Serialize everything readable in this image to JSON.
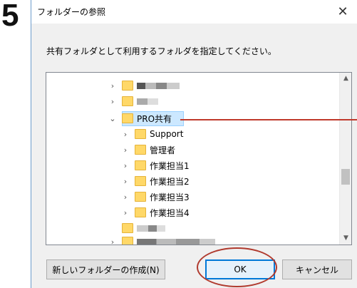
{
  "step_number": "5",
  "dialog": {
    "title": "フォルダーの参照",
    "close_glyph": "✕",
    "instruction": "共有フォルダとして利用するフォルダを指定してください。"
  },
  "tree": {
    "items": [
      {
        "label": "",
        "expanded": false,
        "level": 0,
        "blurred": true
      },
      {
        "label": "",
        "expanded": false,
        "level": 0,
        "blurred": true
      },
      {
        "label": "PRO共有",
        "expanded": true,
        "level": 0,
        "selected": true
      },
      {
        "label": "Support",
        "expanded": false,
        "level": 1
      },
      {
        "label": "管理者",
        "expanded": false,
        "level": 1
      },
      {
        "label": "作業担当1",
        "expanded": false,
        "level": 1
      },
      {
        "label": "作業担当2",
        "expanded": false,
        "level": 1
      },
      {
        "label": "作業担当3",
        "expanded": false,
        "level": 1
      },
      {
        "label": "作業担当4",
        "expanded": false,
        "level": 1
      },
      {
        "label": "",
        "expanded": false,
        "level": 0,
        "blurred": true
      },
      {
        "label": "",
        "expanded": false,
        "level": 0,
        "blurred": true
      }
    ]
  },
  "buttons": {
    "new_folder": "新しいフォルダーの作成(N)",
    "ok": "OK",
    "cancel": "キャンセル"
  },
  "colors": {
    "annotation": "#c0392b",
    "selection": "#cce8ff",
    "folder": "#ffd868",
    "default_button_border": "#0078d7"
  }
}
